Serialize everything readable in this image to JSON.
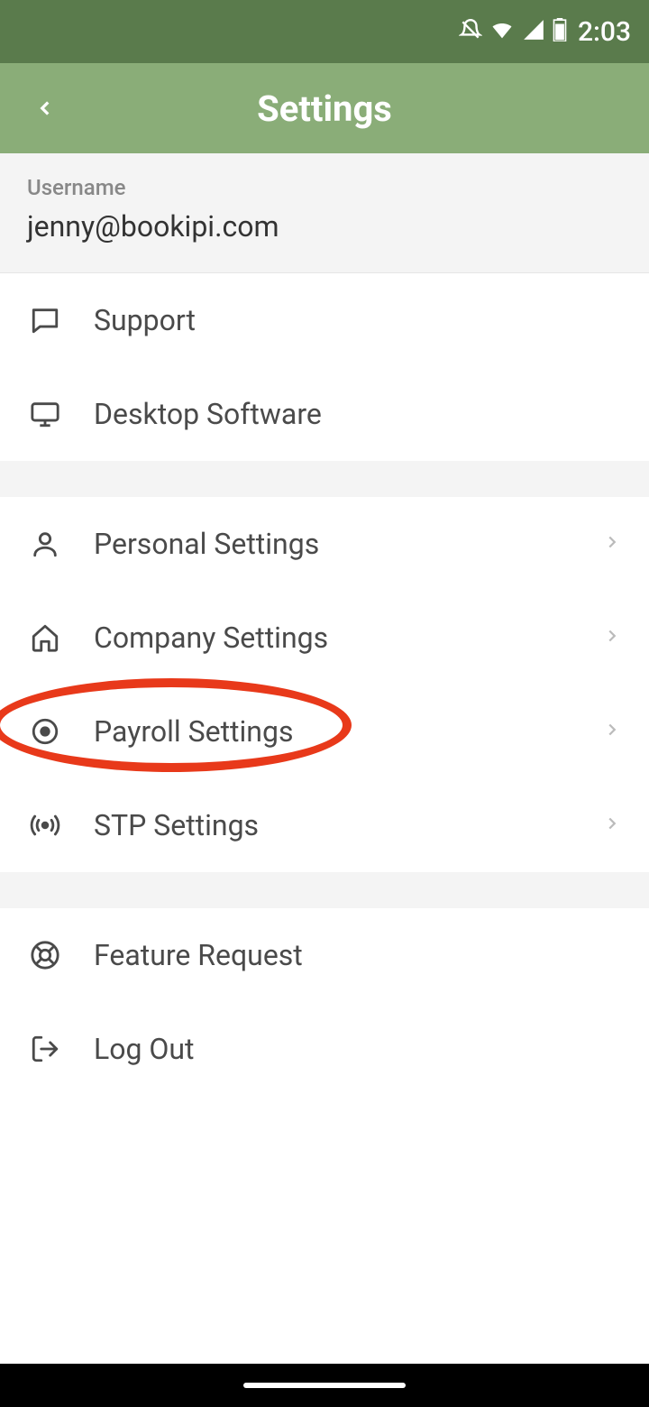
{
  "statusBar": {
    "time": "2:03"
  },
  "header": {
    "title": "Settings"
  },
  "user": {
    "label": "Username",
    "value": "jenny@bookipi.com"
  },
  "groups": [
    {
      "items": [
        {
          "id": "support",
          "label": "Support",
          "icon": "chat",
          "chevron": false
        },
        {
          "id": "desktop",
          "label": "Desktop Software",
          "icon": "monitor",
          "chevron": false
        }
      ]
    },
    {
      "items": [
        {
          "id": "personal",
          "label": "Personal Settings",
          "icon": "person",
          "chevron": true
        },
        {
          "id": "company",
          "label": "Company Settings",
          "icon": "home",
          "chevron": true
        },
        {
          "id": "payroll",
          "label": "Payroll Settings",
          "icon": "target",
          "chevron": true
        },
        {
          "id": "stp",
          "label": "STP Settings",
          "icon": "broadcast",
          "chevron": true
        }
      ]
    },
    {
      "items": [
        {
          "id": "feature",
          "label": "Feature Request",
          "icon": "lifebuoy",
          "chevron": false
        },
        {
          "id": "logout",
          "label": "Log Out",
          "icon": "logout",
          "chevron": false
        }
      ]
    }
  ]
}
